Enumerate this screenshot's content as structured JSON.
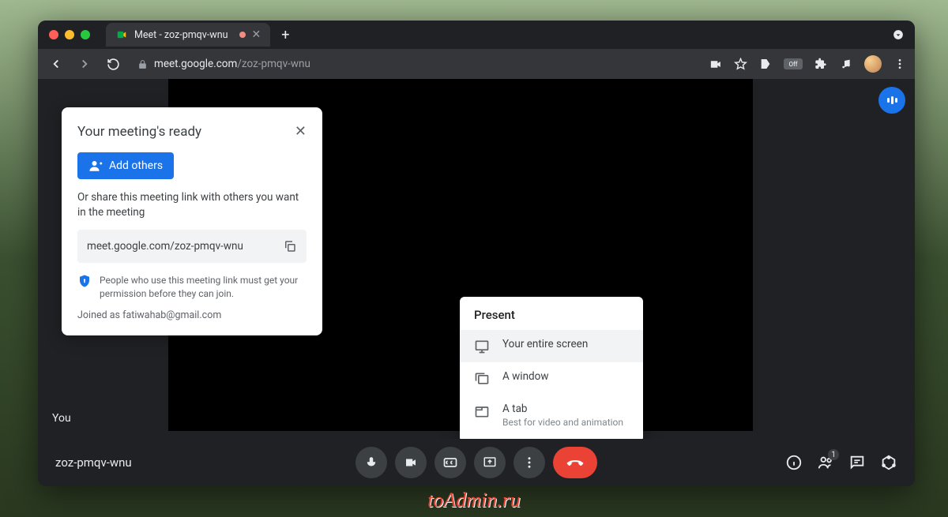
{
  "browser": {
    "tab_title": "Meet - zoz-pmqv-wnu",
    "url_host": "meet.google.com",
    "url_path": "/zoz-pmqv-wnu"
  },
  "meeting": {
    "you_label": "You",
    "id": "zoz-pmqv-wnu",
    "participant_count": "1"
  },
  "ready_card": {
    "title": "Your meeting's ready",
    "add_others": "Add others",
    "share_text": "Or share this meeting link with others you want in the meeting",
    "link": "meet.google.com/zoz-pmqv-wnu",
    "permission_note": "People who use this meeting link must get your permission before they can join.",
    "joined_as": "Joined as fatiwahab@gmail.com"
  },
  "present_menu": {
    "title": "Present",
    "items": [
      {
        "label": "Your entire screen",
        "sublabel": ""
      },
      {
        "label": "A window",
        "sublabel": ""
      },
      {
        "label": "A tab",
        "sublabel": "Best for video and animation"
      }
    ]
  },
  "watermark": "toAdmin.ru"
}
